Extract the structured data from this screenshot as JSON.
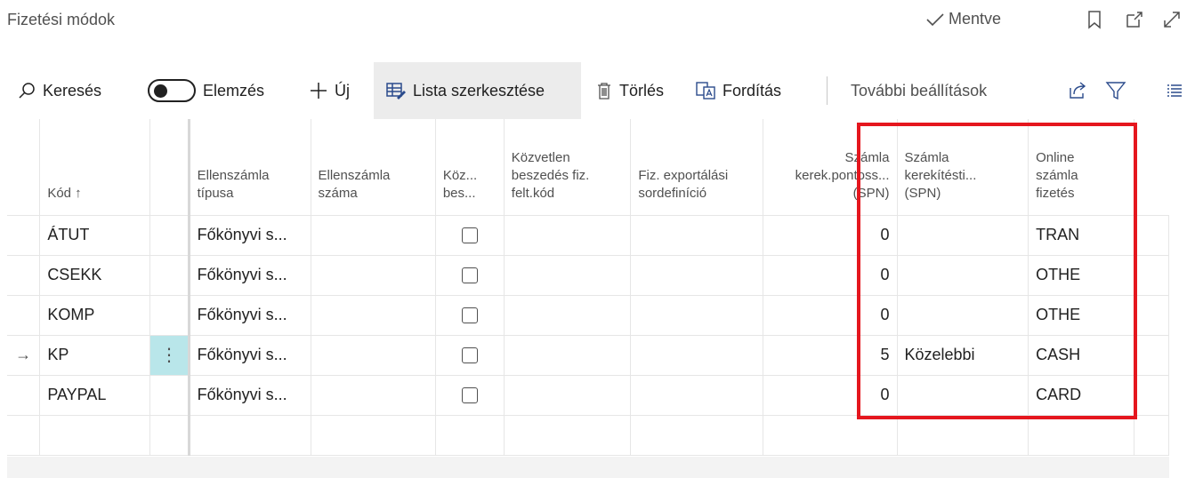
{
  "header": {
    "title": "Fizetési módok",
    "saved_label": "Mentve",
    "icons": [
      "bookmark-icon",
      "open-new-window-icon",
      "expand-icon"
    ]
  },
  "toolbar": {
    "search_label": "Keresés",
    "analysis_label": "Elemzés",
    "new_label": "Új",
    "edit_list_label": "Lista szerkesztése",
    "delete_label": "Törlés",
    "translate_label": "Fordítás",
    "more_label": "További beállítások",
    "icons": [
      "share-icon",
      "filter-icon",
      "list-icon"
    ]
  },
  "columns": {
    "kod": "Kód ↑",
    "ellenszamla_tipus_1": "Ellenszámla",
    "ellenszamla_tipus_2": "típusa",
    "ellenszamla_szam_1": "Ellenszámla",
    "ellenszamla_szam_2": "száma",
    "koz_1": "Köz...",
    "koz_2": "bes...",
    "kozvetlen_1": "Közvetlen",
    "kozvetlen_2": "beszedés fiz.",
    "kozvetlen_3": "felt.kód",
    "fiz_export_1": "Fiz. exportálási",
    "fiz_export_2": "sordefiníció",
    "szamla_kerek_1": "Számla",
    "szamla_kerek_2": "kerek.pontoss...",
    "szamla_kerek_3": "(SPN)",
    "szamla_kerekitesi_1": "Számla",
    "szamla_kerekitesi_2": "kerekítésti...",
    "szamla_kerekitesi_3": "(SPN)",
    "online_1": "Online",
    "online_2": "számla",
    "online_3": "fizetés"
  },
  "rows": [
    {
      "kod": "ÁTUT",
      "tipus": "Főkönyvi s...",
      "pontossag": "0",
      "kerekites": "",
      "online": "TRAN"
    },
    {
      "kod": "CSEKK",
      "tipus": "Főkönyvi s...",
      "pontossag": "0",
      "kerekites": "",
      "online": "OTHE"
    },
    {
      "kod": "KOMP",
      "tipus": "Főkönyvi s...",
      "pontossag": "0",
      "kerekites": "",
      "online": "OTHE"
    },
    {
      "kod": "KP",
      "tipus": "Főkönyvi s...",
      "pontossag": "5",
      "kerekites": "Közelebbi",
      "online": "CASH"
    },
    {
      "kod": "PAYPAL",
      "tipus": "Főkönyvi s...",
      "pontossag": "0",
      "kerekites": "",
      "online": "CARD"
    }
  ],
  "row_marker": "→",
  "row_menu": "⋮",
  "colors": {
    "highlight": "#e5161e",
    "selected_cell": "#b9e6ea",
    "active_button": "#ececec"
  }
}
